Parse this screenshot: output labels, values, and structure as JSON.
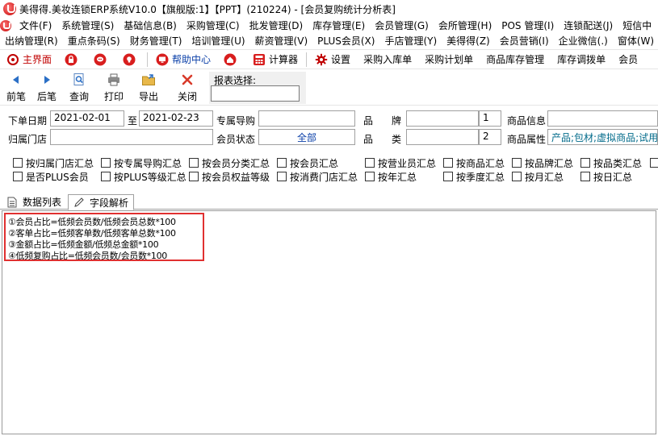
{
  "window": {
    "title": "美得得.美妆连锁ERP系统V10.0【旗舰版:1】【PPT】(210224) - [会员复购统计分析表]"
  },
  "menu_row1": [
    "文件(F)",
    "系统管理(S)",
    "基础信息(B)",
    "采购管理(C)",
    "批发管理(D)",
    "库存管理(E)",
    "会员管理(G)",
    "会所管理(H)",
    "POS 管理(I)",
    "连锁配送(J)",
    "短信中"
  ],
  "menu_row2": [
    "出纳管理(R)",
    "重点条码(S)",
    "财务管理(T)",
    "培训管理(U)",
    "薪资管理(V)",
    "PLUS会员(X)",
    "手店管理(Y)",
    "美得得(Z)",
    "会员营销(I)",
    "企业微信(.)",
    "窗体(W)"
  ],
  "toolbar1": {
    "home": "主界面",
    "help": "帮助中心",
    "calculator": "计算器",
    "settings": "设置",
    "purchase_in": "采购入库单",
    "purchase_plan": "采购计划单",
    "stock_mgmt": "商品库存管理",
    "transfer": "库存调拨单",
    "member": "会员"
  },
  "toolbar2": {
    "prev": "前笔",
    "next": "后笔",
    "query": "查询",
    "print": "打印",
    "export": "导出",
    "close": "关闭",
    "report_select": "报表选择:"
  },
  "form": {
    "order_date_label": "下单日期",
    "date_from": "2021-02-01",
    "to_label": "至",
    "date_to": "2021-02-23",
    "guide_label": "专属导购",
    "brand_label_a": "品",
    "brand_label_b": "牌",
    "brand_num": "1",
    "goods_info_label": "商品信息",
    "store_label": "归属门店",
    "member_status_label": "会员状态",
    "member_status_value": "全部",
    "category_label_a": "品",
    "category_label_b": "类",
    "category_num": "2",
    "goods_attr_label": "商品属性",
    "goods_attr_value": "产品;包材;虚拟商品;试用"
  },
  "checkboxes_row1": [
    "按归属门店汇总",
    "按专属导购汇总",
    "按会员分类汇总",
    "按会员汇总",
    "按营业员汇总",
    "按商品汇总",
    "按品牌汇总",
    "按品类汇总"
  ],
  "checkboxes_row2": [
    "是否PLUS会员",
    "按PLUS等级汇总",
    "按会员权益等级",
    "按消费门店汇总",
    "按年汇总",
    "按季度汇总",
    "按月汇总",
    "按日汇总"
  ],
  "tabs": {
    "data_list": "数据列表",
    "field_analysis": "字段解析"
  },
  "notes": [
    "①会员占比=低频会员数/低频会员总数*100",
    "②客单占比=低频客单数/低频客单总数*100",
    "③金额占比=低频金额/低频总金额*100",
    "④低频复购占比=低频会员数/会员数*100"
  ],
  "colors": {
    "accent_red": "#c00000",
    "link_blue": "#0a3fa8",
    "highlight_border": "#e03030"
  }
}
